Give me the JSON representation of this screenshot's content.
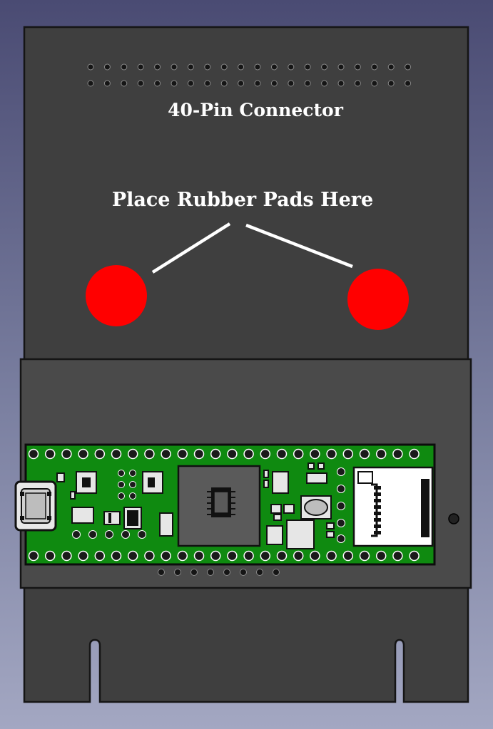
{
  "labels": {
    "connector": "40-Pin Connector",
    "pads": "Place Rubber Pads Here"
  },
  "colors": {
    "plate": "#3f3f3f",
    "band": "#4a4a4a",
    "outline": "#151515",
    "pcb": "#0f8a10",
    "chip": "#5a5a5a",
    "pad": "#ff0000",
    "text": "#ffffff"
  },
  "components": {
    "connector_holes": {
      "rows": 2,
      "columns": 20
    },
    "rubber_pads": 2,
    "board_pins": {
      "top_row": 24,
      "bottom_row": 24
    },
    "expansion_holes": 8,
    "mounting_slots": 2,
    "icons": [
      "usb-connector-icon",
      "microcontroller-chip-icon",
      "sd-card-slot-icon",
      "push-button-icon"
    ]
  }
}
